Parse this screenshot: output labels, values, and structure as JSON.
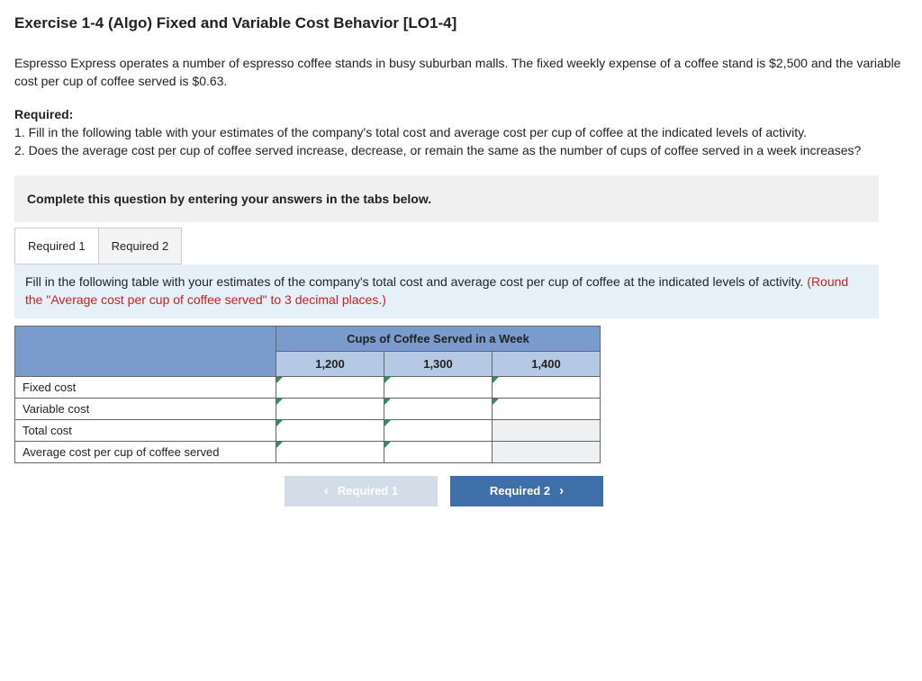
{
  "title": "Exercise 1-4 (Algo) Fixed and Variable Cost Behavior [LO1-4]",
  "intro": "Espresso Express operates a number of espresso coffee stands in busy suburban malls. The fixed weekly expense of a coffee stand is $2,500 and the variable cost per cup of coffee served is $0.63.",
  "required_label": "Required:",
  "required_items": {
    "r1": "1. Fill in the following table with your estimates of the company's total cost and average cost per cup of coffee at the indicated levels of activity.",
    "r2": "2. Does the average cost per cup of coffee served increase, decrease, or remain the same as the number of cups of coffee served in a week increases?"
  },
  "complete_bar": "Complete this question by entering your answers in the tabs below.",
  "tabs": {
    "t1": "Required 1",
    "t2": "Required 2"
  },
  "instruction": {
    "black": "Fill in the following table with your estimates of the company's total cost and average cost per cup of coffee at the indicated levels of activity. ",
    "red": "(Round the \"Average cost per cup of coffee served\" to 3 decimal places.)"
  },
  "table": {
    "merge_header": "Cups of Coffee Served in a Week",
    "cols": {
      "c1": "1,200",
      "c2": "1,300",
      "c3": "1,400"
    },
    "rows": {
      "r1": "Fixed cost",
      "r2": "Variable cost",
      "r3": "Total cost",
      "r4": "Average cost per cup of coffee served"
    }
  },
  "nav": {
    "prev": "Required 1",
    "next": "Required 2"
  }
}
